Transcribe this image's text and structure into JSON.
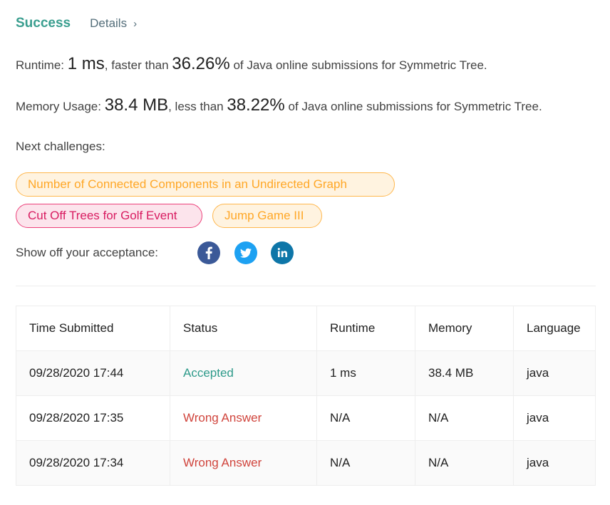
{
  "header": {
    "result": "Success",
    "details_label": "Details"
  },
  "runtime": {
    "label": "Runtime:",
    "value": "1 ms",
    "mid_text": ", faster than",
    "percent": "36.26%",
    "tail_text": "of Java online submissions for Symmetric Tree."
  },
  "memory": {
    "label": "Memory Usage:",
    "value": "38.4 MB",
    "mid_text": ", less than",
    "percent": "38.22%",
    "tail_text": "of Java online submissions for Symmetric Tree."
  },
  "next_challenges": {
    "label": "Next challenges:",
    "items": [
      {
        "title": "Number of Connected Components in an Undirected Graph",
        "difficulty": "medium"
      },
      {
        "title": "Cut Off Trees for Golf Event",
        "difficulty": "hard"
      },
      {
        "title": "Jump Game III",
        "difficulty": "medium"
      }
    ]
  },
  "share": {
    "label": "Show off your acceptance:",
    "icons": [
      "facebook-icon",
      "twitter-icon",
      "linkedin-icon"
    ]
  },
  "table": {
    "headers": [
      "Time Submitted",
      "Status",
      "Runtime",
      "Memory",
      "Language"
    ],
    "rows": [
      {
        "time": "09/28/2020 17:44",
        "status": "Accepted",
        "runtime": "1 ms",
        "memory": "38.4 MB",
        "language": "java"
      },
      {
        "time": "09/28/2020 17:35",
        "status": "Wrong Answer",
        "runtime": "N/A",
        "memory": "N/A",
        "language": "java"
      },
      {
        "time": "09/28/2020 17:34",
        "status": "Wrong Answer",
        "runtime": "N/A",
        "memory": "N/A",
        "language": "java"
      }
    ]
  },
  "colors": {
    "success": "#3a9e8f",
    "accepted": "#2e9a8a",
    "wrong_answer": "#d0443c",
    "medium_chip": "#ffa726",
    "hard_chip": "#d81b60",
    "facebook": "#3b5998",
    "twitter": "#1da1f2",
    "linkedin": "#0e76a8"
  }
}
